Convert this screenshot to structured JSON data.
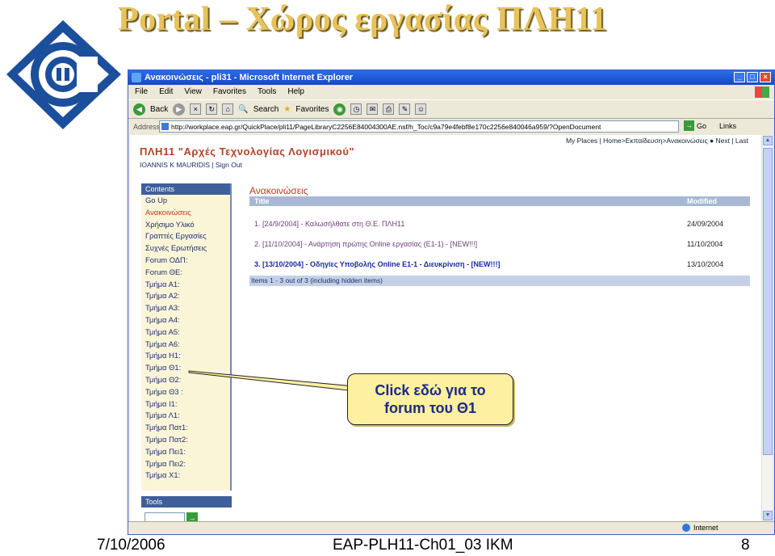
{
  "slide": {
    "title": "Portal – Χώρος εργασίας ΠΛΗ11",
    "footer_date": "7/10/2006",
    "footer_center": "EAP-PLH11-Ch01_03 IKM",
    "page_number": "8"
  },
  "browser": {
    "window_title": "Ανακοινώσεις - pli31 - Microsoft Internet Explorer",
    "menu": [
      "File",
      "Edit",
      "View",
      "Favorites",
      "Tools",
      "Help"
    ],
    "toolbar": {
      "back": "Back",
      "search": "Search",
      "favorites": "Favorites"
    },
    "address_label": "Address",
    "address_url": "http://workplace.eap.gr/QuickPlace/pli11/PageLibraryC2256E84004300AE.nsf/h_Toc/c9a79e4febf8e170c2256e840046a959/?OpenDocument",
    "go_label": "Go",
    "links_label": "Links",
    "status_zone": "Internet"
  },
  "page": {
    "top_nav": "My Places | Home>Εκπαίδευση>Ανακοινώσεις ● Next | Last",
    "course_title": "ΠΛΗ11 \"Αρχές Τεχνολογίας Λογισμικού\"",
    "user_line": "IOANNIS K MAURIDIS | Sign Out",
    "sidebar_header": "Contents",
    "sidebar_items": [
      "Go Up",
      "Ανακοινώσεις",
      "Χρήσιμο Υλικό",
      "Γραπτές Εργασίες",
      "Συχνές Ερωτήσεις",
      "Forum ΟΔΠ:",
      "Forum ΘΕ:",
      "Τμήμα Α1:",
      "Τμήμα Α2:",
      "Τμήμα Α3:",
      "Τμήμα Α4:",
      "Τμήμα Α5:",
      "Τμήμα Α6:",
      "Τμήμα Η1:",
      "Τμήμα Θ1:",
      "Τμήμα Θ2:",
      "Τμήμα Θ3 :",
      "Τμήμα Ι1:",
      "Τμήμα Λ1:",
      "Τμήμα Πατ1:",
      "Τμήμα Πατ2:",
      "Τμήμα Πει1:",
      "Τμήμα Πει2:",
      "Τμήμα Χ1:"
    ],
    "tools_header": "Tools",
    "section_title": "Ανακοινώσεις",
    "table": {
      "col_title": "Title",
      "col_modified": "Modified",
      "rows": [
        {
          "title": "1. [24/9/2004] - Καλωσήλθατε στη Θ.Ε. ΠΛΗ11",
          "date": "24/09/2004"
        },
        {
          "title": "2. [11/10/2004] - Ανάρτηση πρώτης Online εργασίας (Ε1-1) - [NEW!!!]",
          "date": "11/10/2004"
        },
        {
          "title": "3. [13/10/2004] - Οδηγίες Υποβολής Online Ε1-1 - Διευκρίνιση - [NEW!!!]",
          "date": "13/10/2004"
        }
      ],
      "footer": "Items 1 - 3 out of 3 (including hidden items)"
    }
  },
  "callout": {
    "line1": "Click εδώ για το",
    "line2": "forum του Θ1"
  },
  "colors": {
    "title_gold": "#e8c25a",
    "ie_blue": "#1747c4",
    "sidebar_bg": "#fbf5d8",
    "header_blue": "#3e5f9a",
    "callout_bg": "#fdf0a0"
  }
}
